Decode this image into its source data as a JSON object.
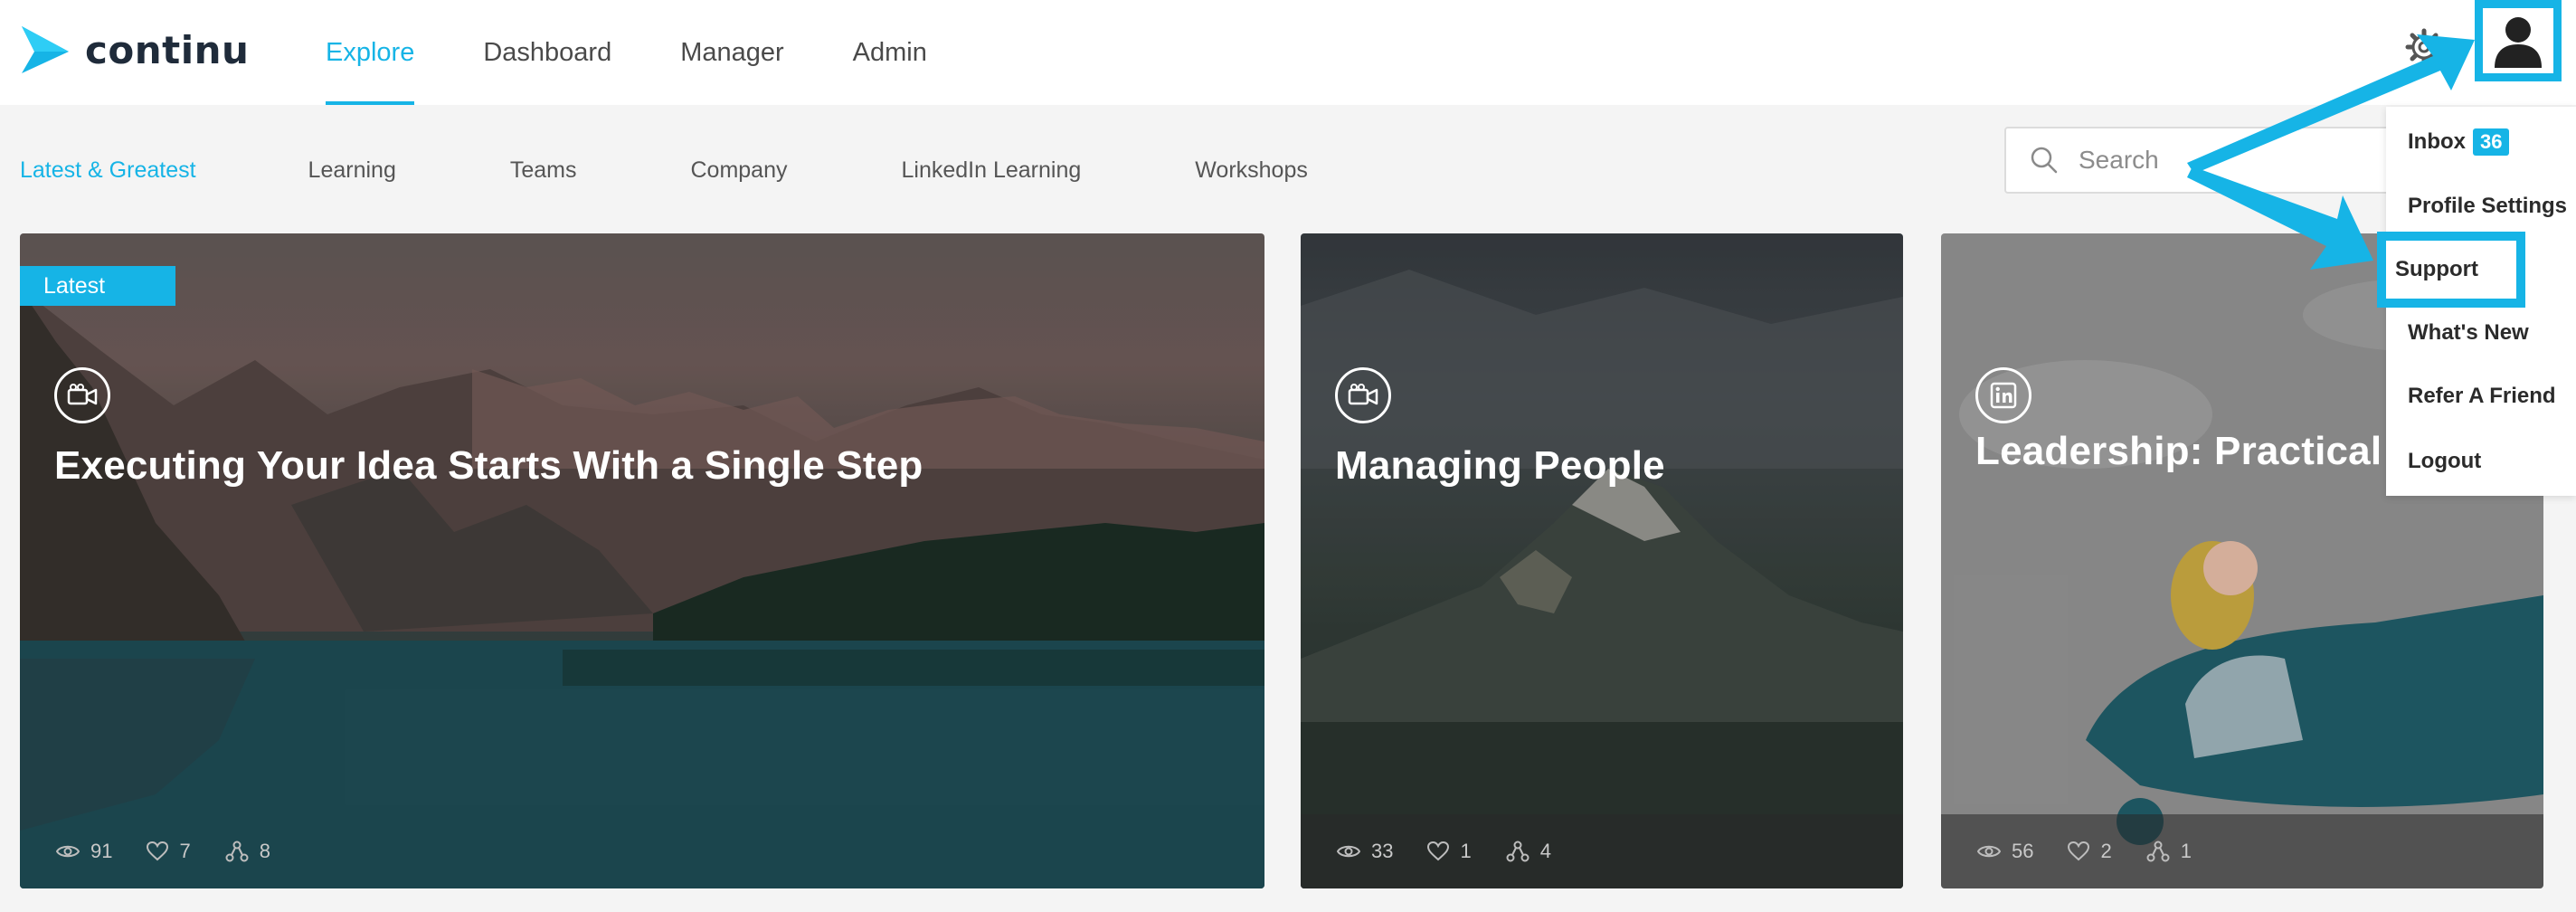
{
  "app": {
    "logo_text": "continu"
  },
  "nav": {
    "items": [
      {
        "label": "Explore",
        "active": true
      },
      {
        "label": "Dashboard",
        "active": false
      },
      {
        "label": "Manager",
        "active": false
      },
      {
        "label": "Admin",
        "active": false
      }
    ]
  },
  "subnav": {
    "items": [
      {
        "label": "Latest & Greatest",
        "active": true
      },
      {
        "label": "Learning",
        "active": false
      },
      {
        "label": "Teams",
        "active": false
      },
      {
        "label": "Company",
        "active": false
      },
      {
        "label": "LinkedIn Learning",
        "active": false
      },
      {
        "label": "Workshops",
        "active": false
      }
    ]
  },
  "search": {
    "placeholder": "Search"
  },
  "cards": [
    {
      "badge": "Latest",
      "title": "Executing Your Idea Starts With a Single Step",
      "type_icon": "video-icon",
      "views": "91",
      "likes": "7",
      "shares": "8"
    },
    {
      "title": "Managing People",
      "type_icon": "video-icon",
      "views": "33",
      "likes": "1",
      "shares": "4"
    },
    {
      "title": "Leadership: Practical S",
      "type_icon": "linkedin-icon",
      "views": "56",
      "likes": "2",
      "shares": "1"
    }
  ],
  "user_menu": {
    "inbox_label": "Inbox",
    "inbox_count": "36",
    "profile_settings": "Profile Settings",
    "support": "Support",
    "whats_new": "What's New",
    "refer": "Refer A Friend",
    "logout": "Logout"
  },
  "colors": {
    "accent": "#16b4e6",
    "text_dark": "#1f2b3a"
  }
}
